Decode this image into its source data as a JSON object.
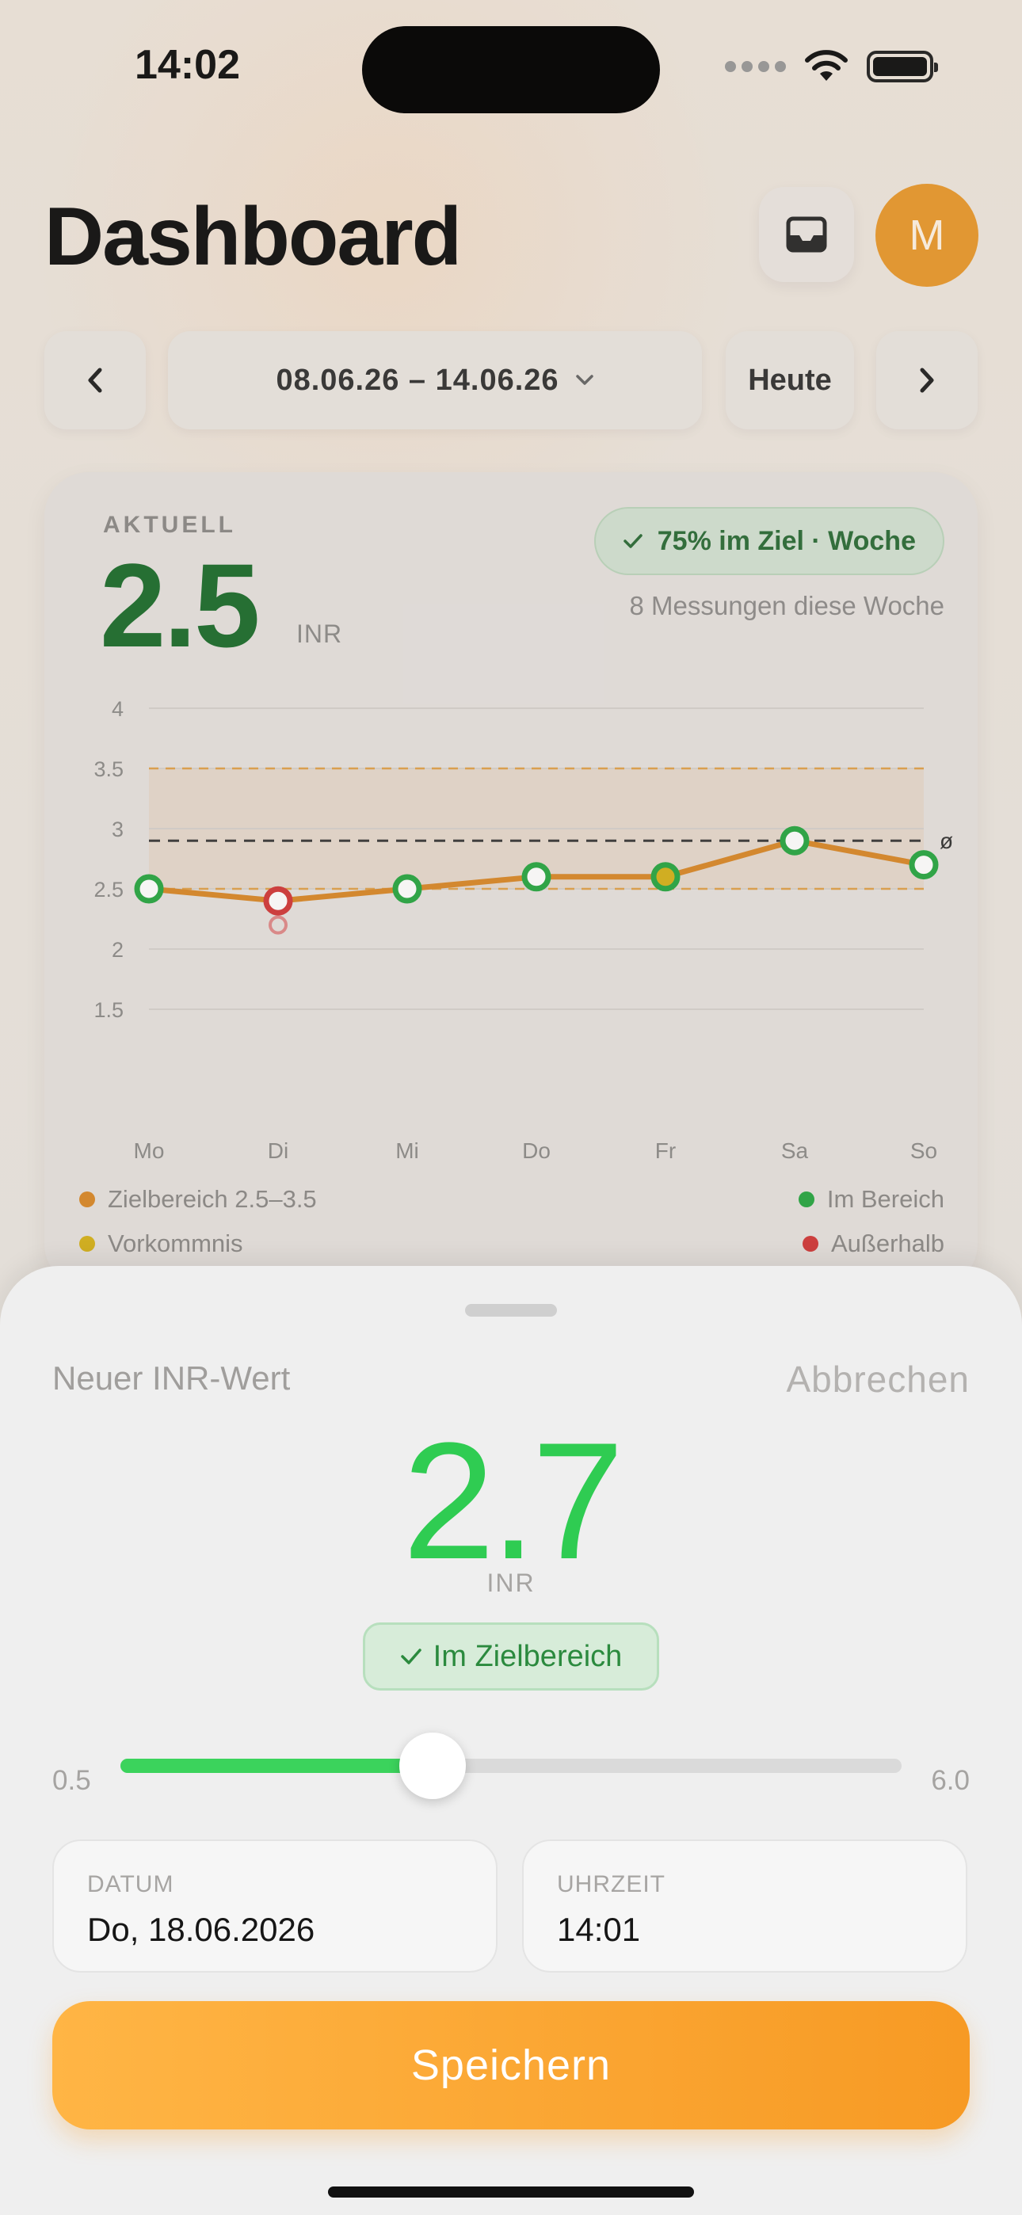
{
  "status_bar": {
    "time": "14:02"
  },
  "header": {
    "title": "Dashboard",
    "avatar_initial": "M"
  },
  "date_nav": {
    "range": "08.06.26 – 14.06.26",
    "today": "Heute"
  },
  "card": {
    "label": "AKTUELL",
    "value": "2.5",
    "unit": "INR",
    "badge": "75% im Ziel · Woche",
    "count_text": "8 Messungen diese Woche",
    "legend": {
      "target_range": "Zielbereich 2.5–3.5",
      "in_range": "Im Bereich",
      "incident": "Vorkommnis",
      "out_of_range": "Außerhalb"
    },
    "colors": {
      "target": "#d9892a",
      "in_range": "#2aa844",
      "incident": "#d6b21c",
      "out_of_range": "#d23a3a"
    }
  },
  "chart_data": {
    "type": "line",
    "categories": [
      "Mo",
      "Di",
      "Mi",
      "Do",
      "Fr",
      "Sa",
      "So"
    ],
    "series": [
      {
        "values": [
          2.5,
          2.4,
          2.5,
          2.6,
          2.6,
          2.9,
          2.7
        ]
      }
    ],
    "extra_points": [
      {
        "x": "Di",
        "y": 2.2
      }
    ],
    "point_status": [
      "in",
      "out",
      "in",
      "in",
      "incident",
      "in",
      "in"
    ],
    "target_range": [
      2.5,
      3.5
    ],
    "average": 2.9,
    "average_label": "ø",
    "yticks": [
      "4",
      "3.5",
      "3",
      "2.5",
      "2",
      "1.5"
    ],
    "ylim": [
      1.5,
      4
    ],
    "grid": true
  },
  "sheet": {
    "title": "Neuer INR-Wert",
    "cancel": "Abbrechen",
    "value": "2.7",
    "unit": "INR",
    "status": "Im Zielbereich",
    "slider": {
      "min_label": "0.5",
      "max_label": "6.0",
      "min": 0.5,
      "max": 6.0,
      "value": 2.7
    },
    "date_label": "DATUM",
    "date_value": "Do, 18.06.2026",
    "time_label": "UHRZEIT",
    "time_value": "14:01",
    "save": "Speichern"
  }
}
